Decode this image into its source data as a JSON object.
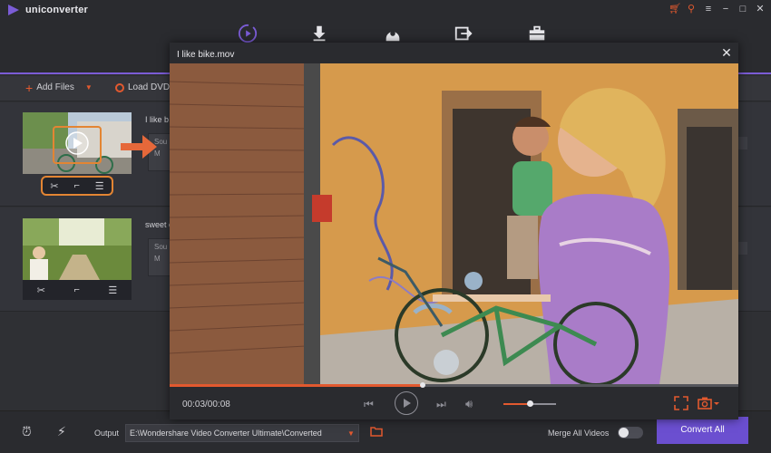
{
  "app": {
    "title": "uniconverter",
    "accent": "#7b5cd6",
    "highlight": "#e2592f"
  },
  "window_buttons": [
    "cart-icon",
    "key-icon",
    "menu-icon",
    "minimize-icon",
    "maximize-icon",
    "close-icon"
  ],
  "nav": {
    "items": [
      {
        "name": "convert",
        "icon": "convert-icon",
        "active": true
      },
      {
        "name": "download",
        "icon": "download-icon",
        "active": false
      },
      {
        "name": "burn",
        "icon": "disc-icon",
        "active": false
      },
      {
        "name": "transfer",
        "icon": "transfer-icon",
        "active": false
      },
      {
        "name": "toolbox",
        "icon": "toolbox-icon",
        "active": false
      }
    ]
  },
  "toolbar": {
    "add_files": "Add Files",
    "load_dvd": "Load DVD"
  },
  "files": [
    {
      "name": "I like b",
      "meta_line1": "Sou",
      "meta_line2": "M",
      "tools": [
        "scissors-icon",
        "crop-icon",
        "effects-icon"
      ]
    },
    {
      "name": "sweet c",
      "meta_line1": "Sou",
      "meta_line2": "M",
      "tools": [
        "scissors-icon",
        "crop-icon",
        "effects-icon"
      ]
    }
  ],
  "player": {
    "title": "I like bike.mov",
    "time": "00:03/00:08",
    "progress": 0.445,
    "volume": 0.5
  },
  "bottom": {
    "output_label": "Output",
    "output_path": "E:\\Wondershare Video Converter Ultimate\\Converted",
    "merge_label": "Merge All Videos",
    "merge_enabled": false,
    "convert_all": "Convert All"
  }
}
